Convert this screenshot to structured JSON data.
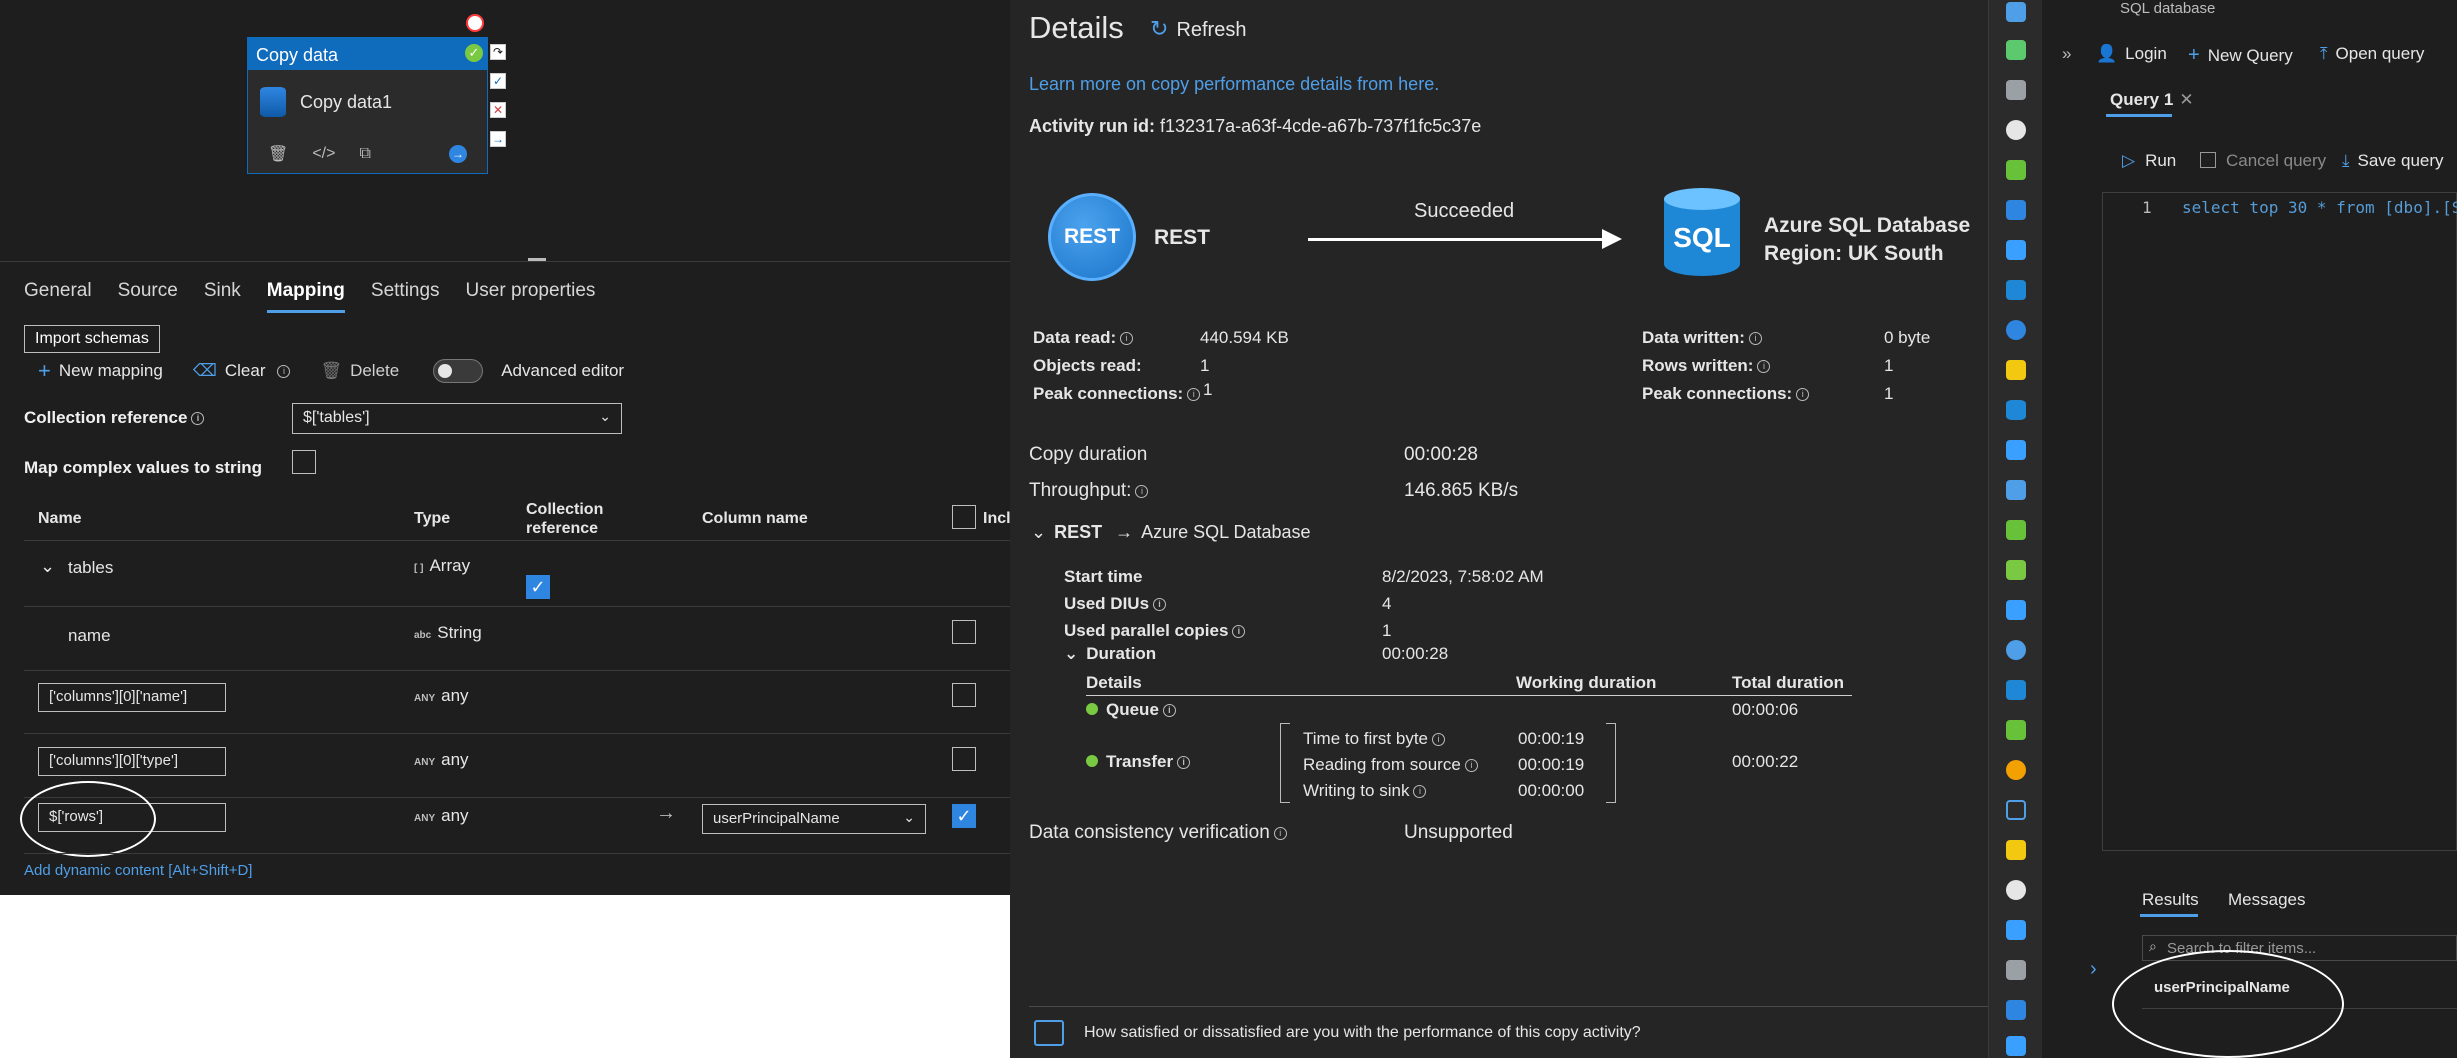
{
  "pipeline": {
    "activity_type": "Copy data",
    "activity_name": "Copy data1"
  },
  "tabs": [
    "General",
    "Source",
    "Sink",
    "Mapping",
    "Settings",
    "User properties"
  ],
  "mapping": {
    "import_schemas": "Import schemas",
    "new_mapping": "New mapping",
    "clear": "Clear",
    "delete": "Delete",
    "advanced_editor": "Advanced editor",
    "collection_reference_label": "Collection reference",
    "collection_reference_value": "$['tables']",
    "map_complex_label": "Map complex values to string",
    "columns": {
      "name": "Name",
      "type": "Type",
      "collection_ref_1": "Collection",
      "collection_ref_2": "reference",
      "column_name": "Column name",
      "include": "Incl"
    },
    "rows": [
      {
        "name": "tables",
        "type_badge": "[ ]",
        "type": "Array"
      },
      {
        "name": "name",
        "type_badge": "abc",
        "type": "String"
      },
      {
        "name": "['columns'][0]['name']",
        "type_badge": "ANY",
        "type": "any"
      },
      {
        "name": "['columns'][0]['type']",
        "type_badge": "ANY",
        "type": "any"
      },
      {
        "name": "$['rows']",
        "type_badge": "ANY",
        "type": "any",
        "column": "userPrincipalName"
      }
    ],
    "add_dynamic": "Add dynamic content [Alt+Shift+D]"
  },
  "details": {
    "title": "Details",
    "refresh": "Refresh",
    "learn_more": "Learn more on copy performance details from here.",
    "run_id_label": "Activity run id:",
    "run_id": "f132317a-a63f-4cde-a67b-737f1fc5c37e",
    "source_badge": "REST",
    "source_name": "REST",
    "status": "Succeeded",
    "sink_badge": "SQL",
    "sink_name": "Azure SQL Database",
    "sink_region": "Region: UK South",
    "left_stats": [
      {
        "label": "Data read:",
        "value": "440.594 KB"
      },
      {
        "label": "Objects read:",
        "value": "1"
      },
      {
        "label": "Peak connections:",
        "value": "1"
      }
    ],
    "right_stats": [
      {
        "label": "Data written:",
        "value": "0 byte"
      },
      {
        "label": "Rows written:",
        "value": "1"
      },
      {
        "label": "Peak connections:",
        "value": "1"
      }
    ],
    "copy_duration_label": "Copy duration",
    "copy_duration": "00:00:28",
    "throughput_label": "Throughput:",
    "throughput": "146.865 KB/s",
    "path_source": "REST",
    "path_sink": "Azure SQL Database",
    "start_time_label": "Start time",
    "start_time": "8/2/2023, 7:58:02 AM",
    "dius_label": "Used DIUs",
    "dius": "4",
    "parallel_label": "Used parallel copies",
    "parallel": "1",
    "duration_label": "Duration",
    "duration": "00:00:28",
    "table_head": {
      "details": "Details",
      "working": "Working duration",
      "total": "Total duration"
    },
    "queue_label": "Queue",
    "queue_total": "00:00:06",
    "transfer_label": "Transfer",
    "transfer_total": "00:00:22",
    "transfer_steps": [
      {
        "label": "Time to first byte",
        "value": "00:00:19"
      },
      {
        "label": "Reading from source",
        "value": "00:00:19"
      },
      {
        "label": "Writing to sink",
        "value": "00:00:00"
      }
    ],
    "consistency_label": "Data consistency verification",
    "consistency": "Unsupported",
    "feedback": "How satisfied or dissatisfied are you with the performance of this copy activity?"
  },
  "sql": {
    "breadcrumb": "SQL database",
    "login": "Login",
    "new_query": "New Query",
    "open_query": "Open query",
    "query_tab": "Query 1",
    "run": "Run",
    "cancel": "Cancel query",
    "save": "Save query",
    "line_no": "1",
    "code": "select top 30 * from [dbo].[S",
    "results_tab": "Results",
    "messages_tab": "Messages",
    "filter_placeholder": "Search to filter items...",
    "result_column": "userPrincipalName"
  },
  "colors": {
    "accent": "#0f6cbd",
    "link": "#4f9fe8",
    "success": "#7ac943",
    "rest_blue": "#1b74c9",
    "sql_blue": "#1e88d6"
  }
}
